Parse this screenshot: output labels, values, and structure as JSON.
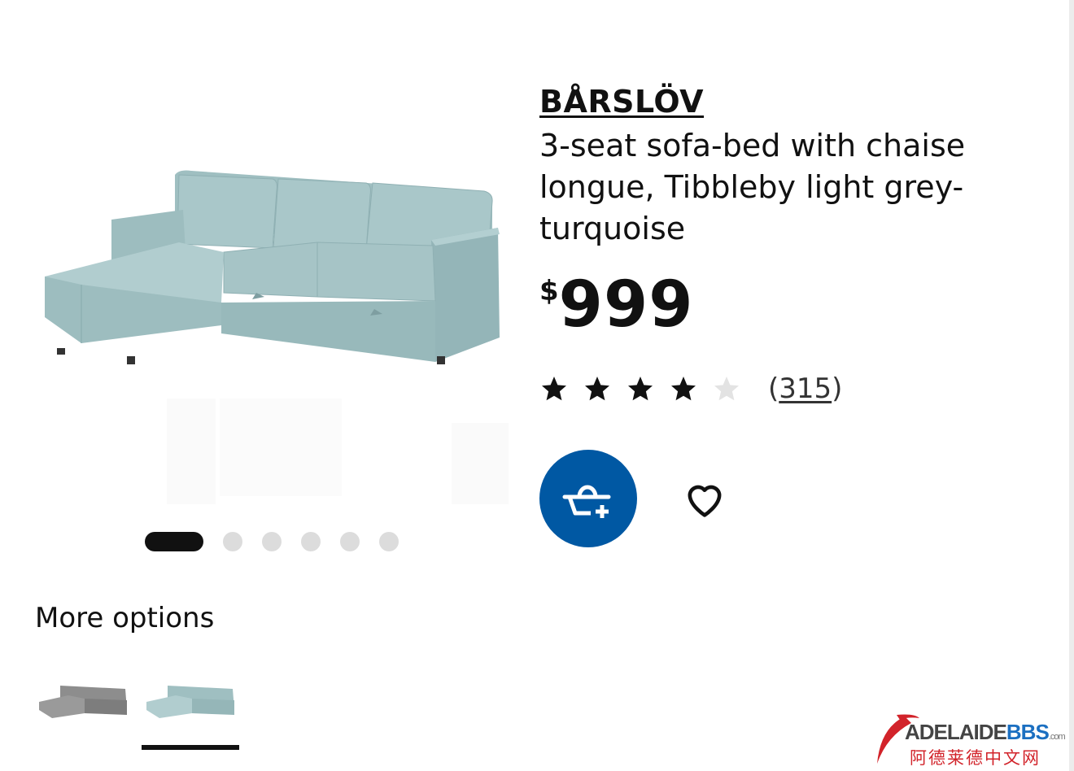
{
  "product": {
    "name": "BÅRSLÖV",
    "description": "3-seat sofa-bed with chaise longue, Tibbleby light grey-turquoise",
    "price_currency": "$",
    "price_amount": "999",
    "rating": {
      "stars_filled": 4,
      "stars_total": 5,
      "review_count": "315",
      "open_paren": "(",
      "close_paren": ")"
    },
    "colors": {
      "sofa": "#a7c4c6",
      "sofa_shadow": "#8fb0b3",
      "accent": "#0058a3"
    }
  },
  "carousel": {
    "total": 6,
    "active_index": 0
  },
  "actions": {
    "add_to_cart_icon": "cart-add-icon",
    "favourite_icon": "heart-icon"
  },
  "more_options": {
    "title": "More options",
    "options": [
      {
        "icon": "sofa-thumbnail-grey",
        "color": "#8d8d8d",
        "selected": false
      },
      {
        "icon": "sofa-thumbnail-turquoise",
        "color": "#a7c4c6",
        "selected": true
      }
    ]
  },
  "watermark": {
    "brand_main": "ADELAIDE",
    "brand_accent": "BBS",
    "brand_domain": ".com",
    "chinese": "阿德莱德中文网"
  }
}
